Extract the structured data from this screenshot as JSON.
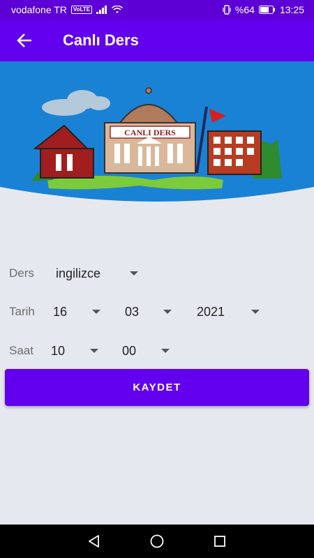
{
  "status_bar": {
    "carrier": "vodafone TR",
    "volte_badge": "VoLTE",
    "battery_text": "%64",
    "time": "13:25"
  },
  "app_bar": {
    "title": "Canlı Ders",
    "back_icon": "arrow-back-icon"
  },
  "banner": {
    "sign_text": "CANLI DERS"
  },
  "form": {
    "ders": {
      "label": "Ders",
      "value": "ingilizce"
    },
    "tarih": {
      "label": "Tarih",
      "day": "16",
      "month": "03",
      "year": "2021"
    },
    "saat": {
      "label": "Saat",
      "hour": "10",
      "minute": "00"
    }
  },
  "save_button": {
    "label": "KAYDET"
  },
  "colors": {
    "primary": "#6200ee",
    "status_bar": "#5c00d6",
    "banner_sky": "#1a82d4",
    "background": "#e5e9ef"
  },
  "nav_bar": {
    "back_icon": "nav-back-icon",
    "home_icon": "nav-home-icon",
    "recents_icon": "nav-recents-icon"
  }
}
